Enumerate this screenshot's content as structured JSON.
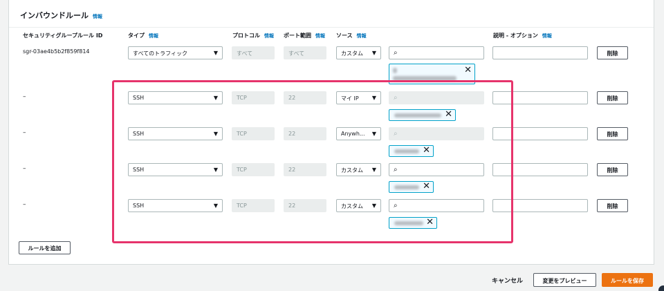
{
  "panel": {
    "title": "インバウンドルール",
    "info": "情報"
  },
  "columns": {
    "rule_id": "セキュリティグループルール ID",
    "type": "タイプ",
    "protocol": "プロトコル",
    "port": "ポート範囲",
    "source": "ソース",
    "desc": "説明 - オプション"
  },
  "rows": [
    {
      "id": "sgr-03ae4b5b2f859f814",
      "type": "すべてのトラフィック",
      "protocol": "すべて",
      "port": "すべて",
      "source": "カスタム",
      "delete": "削除"
    },
    {
      "id": "–",
      "type": "SSH",
      "protocol": "TCP",
      "port": "22",
      "source": "マイ IP",
      "delete": "削除"
    },
    {
      "id": "–",
      "type": "SSH",
      "protocol": "TCP",
      "port": "22",
      "source": "Anywh...",
      "delete": "削除"
    },
    {
      "id": "–",
      "type": "SSH",
      "protocol": "TCP",
      "port": "22",
      "source": "カスタム",
      "delete": "削除"
    },
    {
      "id": "–",
      "type": "SSH",
      "protocol": "TCP",
      "port": "22",
      "source": "カスタム",
      "delete": "削除"
    }
  ],
  "add_rule": "ルールを追加",
  "footer": {
    "cancel": "キャンセル",
    "preview": "変更をプレビュー",
    "save": "ルールを保存"
  },
  "colors": {
    "accent": "#ec7211",
    "link": "#0073bb",
    "highlight": "#e6336b",
    "token_border": "#00a1c9"
  },
  "icons": {
    "dropdown": "caret-down-icon",
    "search": "search-icon",
    "remove": "close-icon"
  }
}
